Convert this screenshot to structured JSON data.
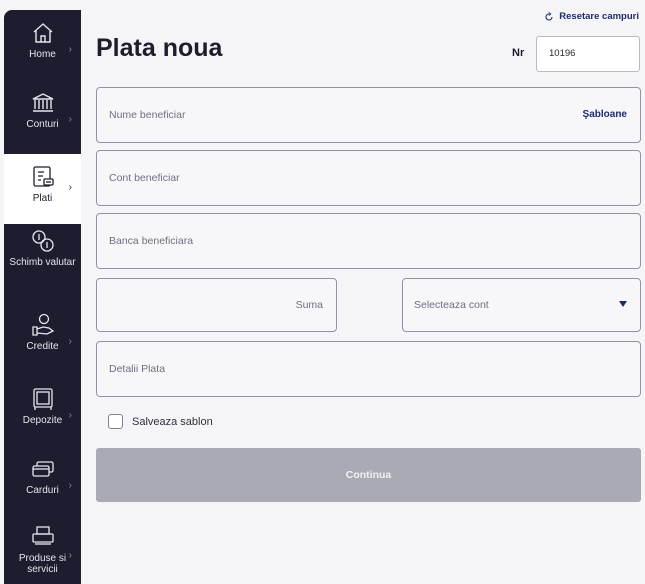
{
  "sidebar": {
    "items": [
      {
        "label": "Home",
        "icon": "home-icon"
      },
      {
        "label": "Conturi",
        "icon": "bank-icon"
      },
      {
        "label": "Plati",
        "icon": "payment-icon",
        "active": true
      },
      {
        "label": "Schimb valutar",
        "icon": "currency-exchange-icon"
      },
      {
        "label": "Credite",
        "icon": "credit-icon"
      },
      {
        "label": "Depozite",
        "icon": "safe-icon"
      },
      {
        "label": "Carduri",
        "icon": "card-icon"
      },
      {
        "label": "Produse si servicii",
        "icon": "printer-icon"
      }
    ]
  },
  "header": {
    "reset_label": "Resetare campuri",
    "title": "Plata noua",
    "nr_label": "Nr",
    "nr_value": "10196"
  },
  "form": {
    "beneficiary_name_placeholder": "Nume beneficiar",
    "templates_label": "Şabloane",
    "beneficiary_account_placeholder": "Cont beneficiar",
    "beneficiary_bank_placeholder": "Banca beneficiara",
    "amount_placeholder": "Suma",
    "account_select_placeholder": "Selecteaza cont",
    "details_placeholder": "Detalii Plata",
    "save_template_label": "Salveaza sablon",
    "continue_label": "Continua"
  },
  "colors": {
    "sidebar_bg": "#1c1d2e",
    "accent": "#1e2a6e",
    "button_disabled": "#a8aab4"
  }
}
